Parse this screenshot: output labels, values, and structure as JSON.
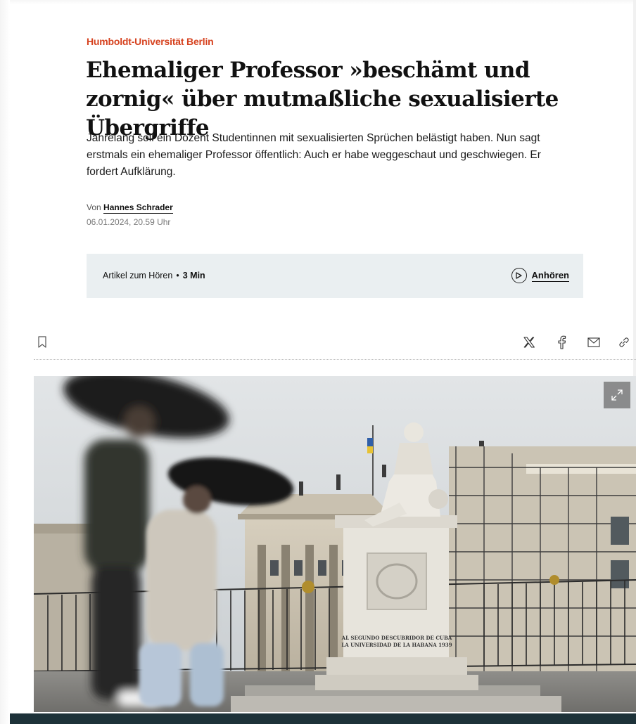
{
  "article": {
    "kicker": "Humboldt-Universität Berlin",
    "headline": "Ehemaliger Professor »beschämt und zornig« über mutmaßliche sexualisierte Übergriffe",
    "teaser": "Jahrelang soll ein Dozent Studentinnen mit sexualisierten Sprüchen belästigt haben. Nun sagt erstmals ein ehemaliger Professor öffentlich: Auch er habe weggeschaut und geschwiegen. Er fordert Aufklärung.",
    "byline_prefix": "Von",
    "author": "Hannes Schrader",
    "date": "06.01.2024, 20.59 Uhr"
  },
  "audio": {
    "label": "Artikel zum Hören",
    "separator": "•",
    "duration": "3 Min",
    "listen_label": "Anhören"
  },
  "toolbar": {
    "bookmark_icon": "bookmark-icon",
    "share_icons": [
      "x-icon",
      "facebook-icon",
      "mail-icon",
      "link-icon"
    ]
  },
  "image": {
    "inscription_line1": "AL SEGUNDO DESCUBRIDOR DE CUBA",
    "inscription_line2": "LA UNIVERSIDAD DE LA HABANA 1939",
    "expand_icon": "expand-icon"
  },
  "colors": {
    "kicker": "#d6421f",
    "audio_box": "#eaeff1",
    "bottom_bar": "#1d3239"
  }
}
